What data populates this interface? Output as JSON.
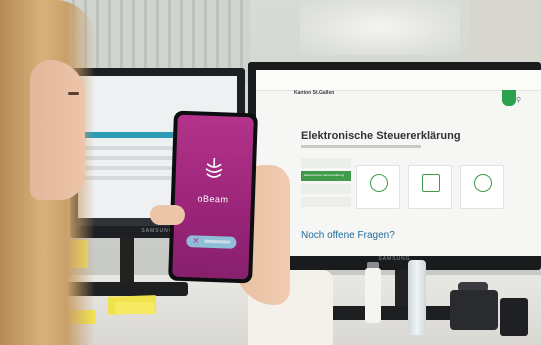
{
  "left_monitor": {
    "brand": "SAMSUNG"
  },
  "right_monitor": {
    "brand": "SAMSUNG",
    "site": {
      "title": "Kanton St.Gallen",
      "heading": "Elektronische Steuererklärung",
      "faq_heading": "Noch offene Fragen?",
      "nav_active": "Elektronische Steuererklärung"
    }
  },
  "phone": {
    "app_name": "oBeam"
  },
  "colors": {
    "app_background": "#b3348a",
    "site_accent": "#3f9a4a",
    "faq_text": "#1f6a9a"
  },
  "icons": [
    "obeam-logo-icon",
    "crest-icon",
    "search-icon",
    "user-icon",
    "chart-icon",
    "globe-icon",
    "scan-icon"
  ]
}
